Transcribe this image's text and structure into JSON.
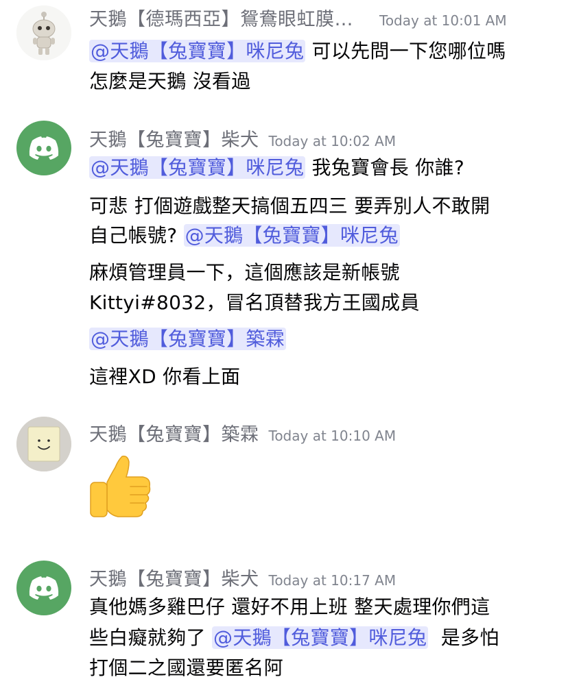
{
  "messages": [
    {
      "username": "天鵝【德瑪西亞】鴛鴦眼虹膜…",
      "timestamp": "Today at 10:01 AM",
      "mention1": "@天鵝【兔寶寶】咪尼兔",
      "line1_text": " 可以先問一下您哪位嗎",
      "line2_text": "怎麼是天鵝 沒看過"
    },
    {
      "username": "天鵝【兔寶寶】柴犬",
      "timestamp": "Today at 10:02 AM",
      "mention1": "@天鵝【兔寶寶】咪尼兔",
      "line1_text": " 我兔寶會長 你誰?",
      "line2_text": "可悲 打個遊戲整天搞個五四三 要弄別人不敢開",
      "line3_text": "自己帳號? ",
      "mention2": "@天鵝【兔寶寶】咪尼兔",
      "line4_text": "麻煩管理員一下，這個應該是新帳號",
      "line5_text": "Kittyi#8032，冒名頂替我方王國成員",
      "mention3": "@天鵝【兔寶寶】築霖",
      "line6_text": "這裡XD 你看上面"
    },
    {
      "username": "天鵝【兔寶寶】築霖",
      "timestamp": "Today at 10:10 AM",
      "emoji": "thumbs-up"
    },
    {
      "username": "天鵝【兔寶寶】柴犬",
      "timestamp": "Today at 10:17 AM",
      "line1_text": "真他媽多雞巴仔 還好不用上班 整天處理你們這",
      "line2_pre": "些白癡就夠了 ",
      "mention1": "@天鵝【兔寶寶】咪尼兔",
      "line2_post": "  是多怕",
      "line3_text": "打個二之國還要匿名阿"
    }
  ],
  "colors": {
    "mention_bg": "#e6e8fd",
    "mention_fg": "#505cdc",
    "discord_green": "#57a663",
    "username_gray": "#6d6f78",
    "timestamp_gray": "#80848e"
  },
  "icons": {
    "avatar1": "robot-figure-icon",
    "avatar2": "discord-logo-icon",
    "avatar3": "smiley-note-icon",
    "avatar4": "discord-logo-icon"
  }
}
